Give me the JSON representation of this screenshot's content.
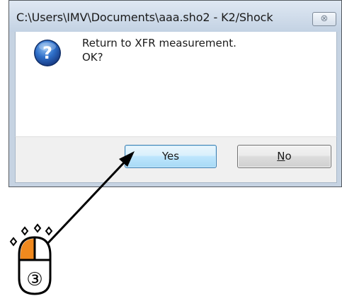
{
  "dialog": {
    "title": "C:\\Users\\IMV\\Documents\\aaa.sho2 - K2/Shock",
    "close_glyph": "⊗",
    "icon": "question-icon",
    "message_line1": "Return to XFR measurement.",
    "message_line2": "OK?",
    "buttons": {
      "yes_label": "Yes",
      "no_label_accel": "N",
      "no_label_rest": "o"
    }
  },
  "annotation": {
    "step_number": "③",
    "icon": "mouse-left-click-icon",
    "highlight_color": "#f0891e"
  }
}
